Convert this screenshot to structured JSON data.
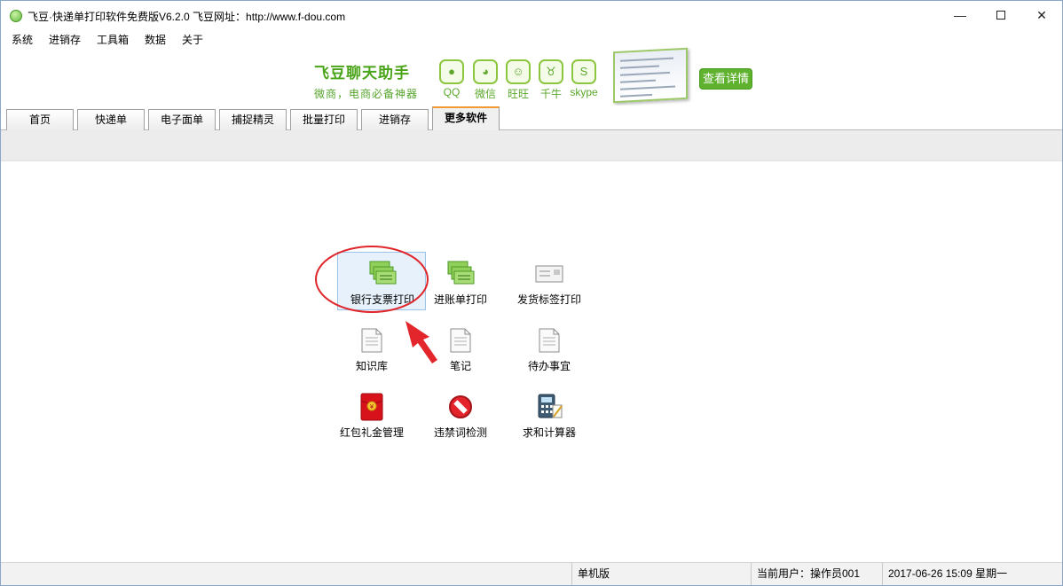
{
  "window": {
    "title": "飞豆·快递单打印软件免费版V6.2.0   飞豆网址：http://www.f-dou.com",
    "minimize_glyph": "—",
    "close_glyph": "✕"
  },
  "menu": [
    "系统",
    "进销存",
    "工具箱",
    "数据",
    "关于"
  ],
  "banner": {
    "title": "飞豆聊天助手",
    "subtitle": "微商，电商必备神器",
    "apps": [
      {
        "label": "QQ",
        "icon": "qq-icon",
        "glyph": "●"
      },
      {
        "label": "微信",
        "icon": "wechat-icon",
        "glyph": "◕"
      },
      {
        "label": "旺旺",
        "icon": "wangwang-icon",
        "glyph": "☺"
      },
      {
        "label": "千牛",
        "icon": "qianniu-icon",
        "glyph": "♉"
      },
      {
        "label": "skype",
        "icon": "skype-icon",
        "glyph": "S"
      }
    ],
    "detail_button": "查看详情",
    "accent_color": "#5fb22e"
  },
  "tabs": [
    "首页",
    "快递单",
    "电子面单",
    "捕捉精灵",
    "批量打印",
    "进销存",
    "更多软件"
  ],
  "active_tab": "更多软件",
  "tools": [
    {
      "label": "银行支票打印",
      "icon": "bank-cheque-icon"
    },
    {
      "label": "进账单打印",
      "icon": "deposit-slip-icon"
    },
    {
      "label": "发货标签打印",
      "icon": "shipping-label-icon"
    },
    {
      "label": "知识库",
      "icon": "knowledge-base-icon"
    },
    {
      "label": "笔记",
      "icon": "notes-icon"
    },
    {
      "label": "待办事宜",
      "icon": "todo-icon"
    },
    {
      "label": "红包礼金管理",
      "icon": "red-envelope-icon"
    },
    {
      "label": "违禁词检测",
      "icon": "forbidden-words-icon"
    },
    {
      "label": "求和计算器",
      "icon": "calculator-icon"
    }
  ],
  "annotation_color": "#e0262b",
  "status": {
    "mode": "单机版",
    "user": "当前用户：操作员001",
    "datetime": "2017-06-26 15:09 星期一"
  }
}
